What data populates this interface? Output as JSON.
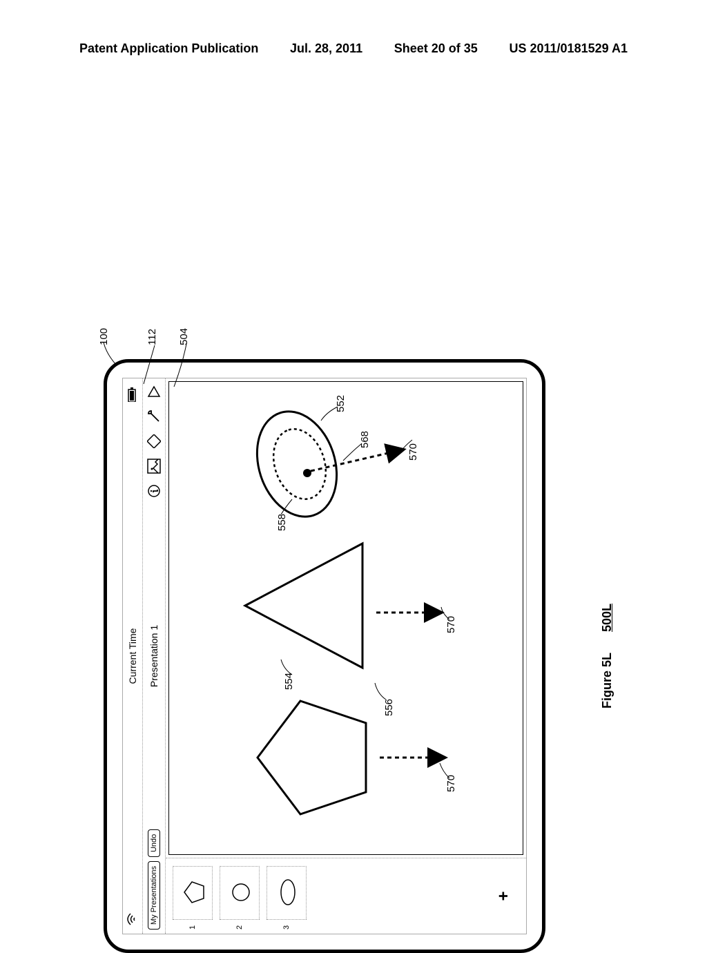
{
  "header": {
    "left": "Patent Application Publication",
    "date": "Jul. 28, 2011",
    "sheet": "Sheet 20 of 35",
    "pubno": "US 2011/0181529 A1"
  },
  "figure": {
    "label": "Figure 5L",
    "id": "500L"
  },
  "status": {
    "time": "Current Time"
  },
  "toolbar": {
    "my_presentations": "My Presentations",
    "undo": "Undo",
    "title": "Presentation 1"
  },
  "slides": {
    "items": [
      {
        "num": "1"
      },
      {
        "num": "2"
      },
      {
        "num": "3"
      }
    ],
    "add": "+"
  },
  "refs": {
    "r100": "100",
    "r112": "112",
    "r504": "504",
    "r552": "552",
    "r554": "554",
    "r556": "556",
    "r558": "558",
    "r568": "568",
    "r570a": "570",
    "r570b": "570",
    "r570c": "570"
  }
}
